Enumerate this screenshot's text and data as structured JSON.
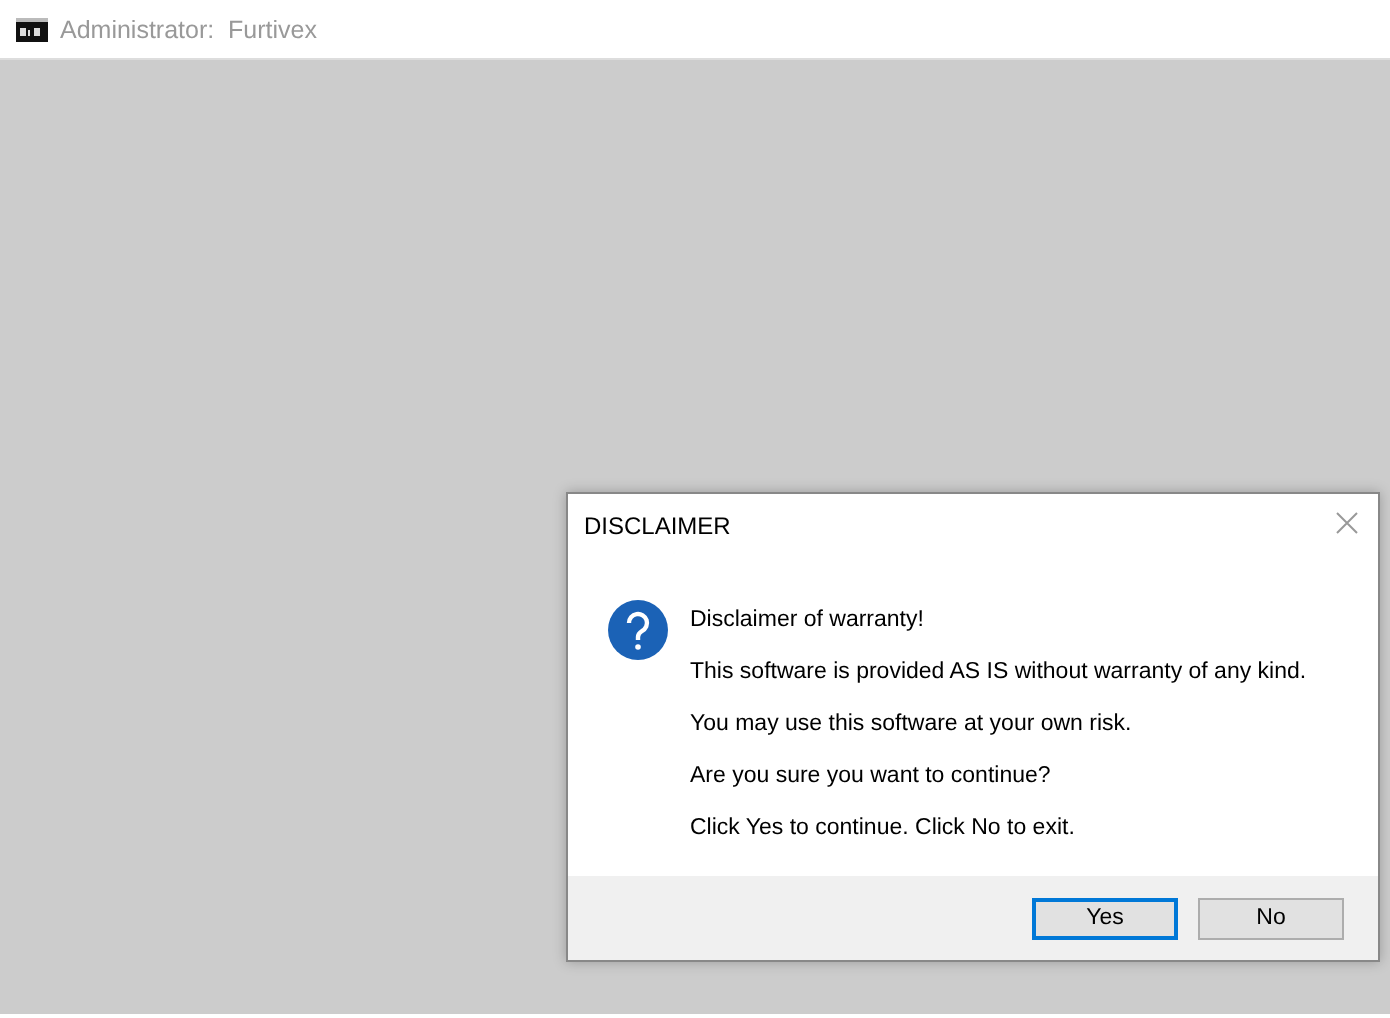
{
  "window": {
    "title": "Administrator:  Furtivex"
  },
  "dialog": {
    "title": "DISCLAIMER",
    "lines": [
      "Disclaimer of warranty!",
      "This software is provided AS IS without warranty of any kind.",
      "You may use this software at your own risk.",
      "Are you sure you want to continue?",
      "Click Yes to continue. Click No to exit."
    ],
    "buttons": [
      {
        "label": "Yes",
        "focused": true
      },
      {
        "label": "No",
        "focused": false
      }
    ]
  }
}
